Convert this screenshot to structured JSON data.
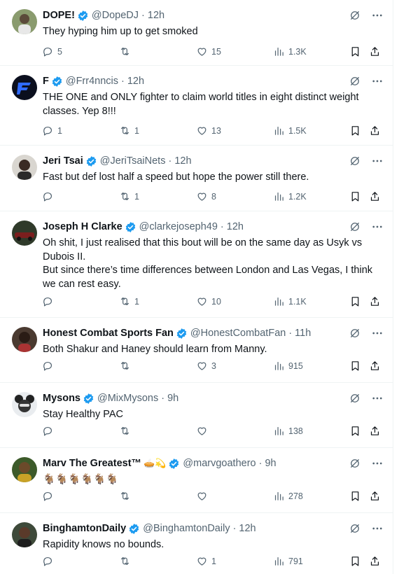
{
  "colors": {
    "verified": "#1d9bf0",
    "text": "#0f1419",
    "muted": "#536471",
    "divider": "#eff3f4"
  },
  "tweets": [
    {
      "name": "DOPE!",
      "verified": true,
      "handle": "@DopeDJ",
      "time": "12h",
      "lines": [
        "They hyping him up to get smoked"
      ],
      "replies": "5",
      "retweets": "",
      "likes": "15",
      "views": "1.3K",
      "avatar_icon": "person-avatar"
    },
    {
      "name": "F",
      "verified": true,
      "handle": "@Frr4nncis",
      "time": "12h",
      "lines": [
        "THE ONE and ONLY fighter to claim world titles in eight distinct weight",
        "classes. Yep 8!!!"
      ],
      "replies": "1",
      "retweets": "1",
      "likes": "13",
      "views": "1.5K",
      "avatar_icon": "logo-avatar"
    },
    {
      "name": "Jeri Tsai",
      "verified": true,
      "handle": "@JeriTsaiNets",
      "time": "12h",
      "lines": [
        "Fast but def lost half a speed but hope the power still there."
      ],
      "replies": "",
      "retweets": "1",
      "likes": "8",
      "views": "1.2K",
      "avatar_icon": "person-avatar"
    },
    {
      "name": "Joseph H Clarke",
      "verified": true,
      "handle": "@clarkejoseph49",
      "time": "12h",
      "lines": [
        "Oh shit, I just realised that this bout will be on the same day as Usyk vs",
        "Dubois II.",
        "But since there’s time differences between London and Las Vegas, I think",
        "we can rest easy."
      ],
      "replies": "",
      "retweets": "1",
      "likes": "10",
      "views": "1.1K",
      "avatar_icon": "car-avatar"
    },
    {
      "name": "Honest Combat Sports Fan",
      "verified": true,
      "handle": "@HonestCombatFan",
      "time": "11h",
      "lines": [
        "Both Shakur and Haney should learn from Manny."
      ],
      "replies": "",
      "retweets": "",
      "likes": "3",
      "views": "915",
      "avatar_icon": "person-avatar"
    },
    {
      "name": "Mysons",
      "verified": true,
      "handle": "@MixMysons",
      "time": "9h",
      "lines": [
        "Stay Healthy PAC"
      ],
      "replies": "",
      "retweets": "",
      "likes": "",
      "views": "138",
      "avatar_icon": "mouse-avatar"
    },
    {
      "name": "Marv The Greatest™",
      "emoji": "🥧💫",
      "verified": true,
      "handle": "@marvgoathero",
      "time": "9h",
      "lines": [
        "🐐🐐🐐🐐🐐🐐"
      ],
      "replies": "",
      "retweets": "",
      "likes": "",
      "views": "278",
      "avatar_icon": "person-avatar"
    },
    {
      "name": "BinghamtonDaily",
      "verified": true,
      "handle": "@BinghamtonDaily",
      "time": "12h",
      "lines": [
        "Rapidity knows no bounds."
      ],
      "replies": "",
      "retweets": "",
      "likes": "1",
      "views": "791",
      "avatar_icon": "person-avatar"
    }
  ]
}
